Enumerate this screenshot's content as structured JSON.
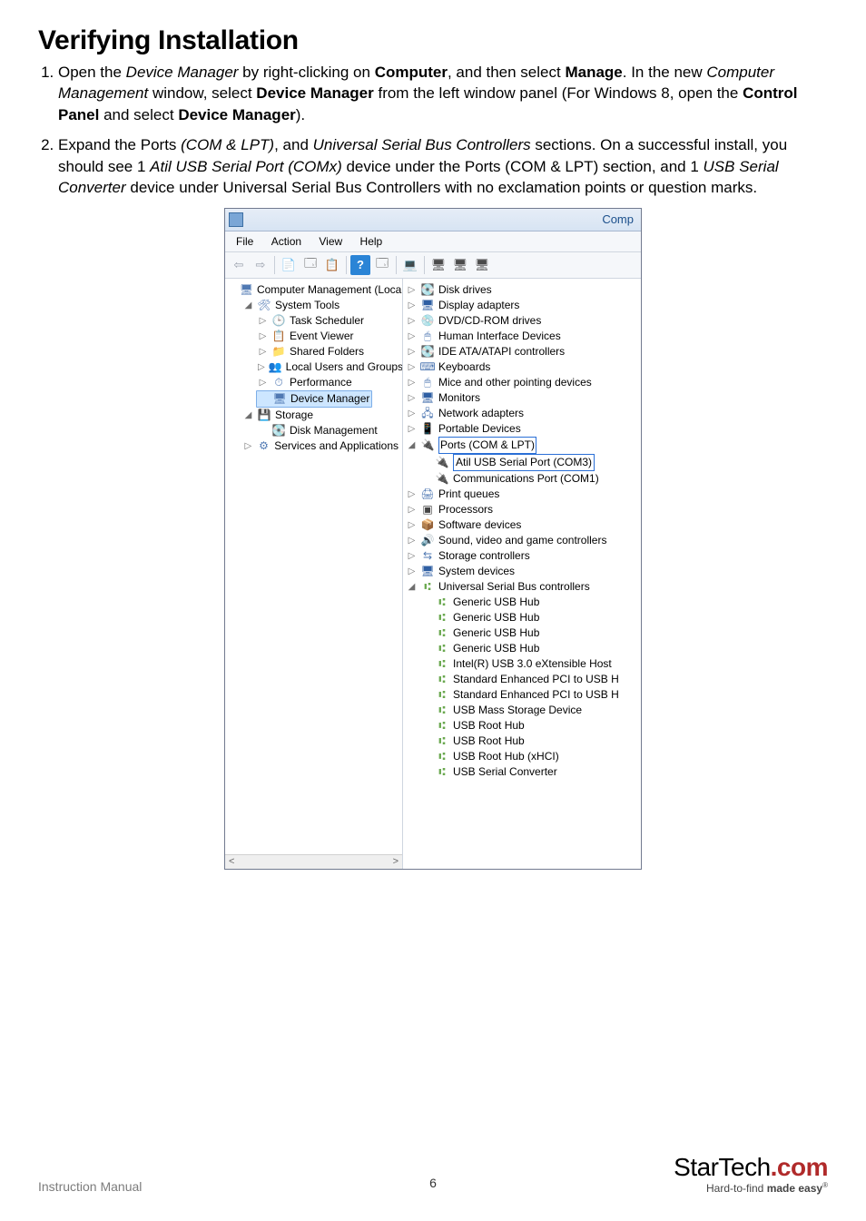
{
  "page": {
    "heading": "Verifying Installation",
    "footer_label": "Instruction Manual",
    "page_number": "6",
    "brand_name": "StarTech",
    "brand_suffix": ".com",
    "tagline_prefix": "Hard-to-find ",
    "tagline_bold": "made easy",
    "tagline_mark": "®"
  },
  "steps": {
    "s1": {
      "t1": "Open the ",
      "i1": "Device Manager",
      "t2": " by right-clicking on ",
      "b1": "Computer",
      "t3": ", and then select ",
      "b2": "Manage",
      "t4": ". In the new ",
      "i2": "Computer Management",
      "t5": " window, select ",
      "b3": "Device Manager",
      "t6": " from the left window panel (For Windows 8, open the ",
      "b4": "Control Panel",
      "t7": " and select ",
      "b5": "Device Manager",
      "t8": ")."
    },
    "s2": {
      "t1": "Expand the Ports ",
      "i1": "(COM & LPT)",
      "t2": ", and ",
      "i2": "Universal Serial Bus Controllers",
      "t3": " sections. On a successful install, you should see 1 ",
      "i3": "Atil USB Serial Port (COMx)",
      "t4": " device under the Ports (COM & LPT) section, and 1 ",
      "i4": "USB Serial Converter",
      "t5": " device under Universal Serial Bus Controllers with no exclamation points or question marks."
    }
  },
  "win": {
    "title": "Comp",
    "menu": {
      "file": "File",
      "action": "Action",
      "view": "View",
      "help": "Help"
    },
    "left": {
      "root": "Computer Management (Local",
      "systools": "System Tools",
      "task": "Task Scheduler",
      "event": "Event Viewer",
      "shared": "Shared Folders",
      "users": "Local Users and Groups",
      "perf": "Performance",
      "devmgr": "Device Manager",
      "storage": "Storage",
      "diskmgmt": "Disk Management",
      "services": "Services and Applications",
      "scroll_left": "<",
      "scroll_right": ">"
    },
    "right": {
      "disk": "Disk drives",
      "display": "Display adapters",
      "dvd": "DVD/CD-ROM drives",
      "hid": "Human Interface Devices",
      "ide": "IDE ATA/ATAPI controllers",
      "kbd": "Keyboards",
      "mice": "Mice and other pointing devices",
      "mon": "Monitors",
      "net": "Network adapters",
      "portdev": "Portable Devices",
      "ports": "Ports (COM & LPT)",
      "atil": "Atil USB Serial Port (COM3)",
      "com1": "Communications Port (COM1)",
      "printq": "Print queues",
      "proc": "Processors",
      "softdev": "Software devices",
      "sound": "Sound, video and game controllers",
      "storctl": "Storage controllers",
      "sysdev": "System devices",
      "usbctl": "Universal Serial Bus controllers",
      "gh1": "Generic USB Hub",
      "gh2": "Generic USB Hub",
      "gh3": "Generic USB Hub",
      "gh4": "Generic USB Hub",
      "intel": "Intel(R) USB 3.0 eXtensible Host",
      "std1": "Standard Enhanced PCI to USB H",
      "std2": "Standard Enhanced PCI to USB H",
      "mass": "USB Mass Storage Device",
      "root1": "USB Root Hub",
      "root2": "USB Root Hub",
      "rootx": "USB Root Hub (xHCI)",
      "serial": "USB Serial Converter"
    }
  }
}
